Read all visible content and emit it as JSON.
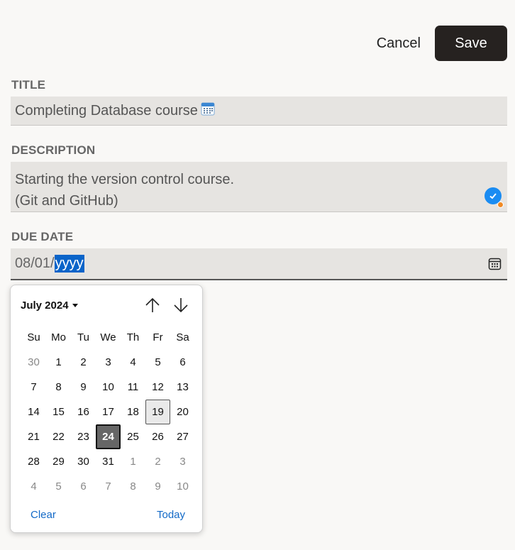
{
  "actions": {
    "cancel_label": "Cancel",
    "save_label": "Save"
  },
  "title": {
    "label": "TITLE",
    "value": "Completing Database course"
  },
  "description": {
    "label": "DESCRIPTION",
    "lines": [
      "Starting the version control course.",
      "(Git and GitHub)"
    ]
  },
  "due_date": {
    "label": "DUE DATE",
    "prefix": "08/01/",
    "selected": "yyyy"
  },
  "calendar": {
    "month_label": "July 2024",
    "weekdays": [
      "Su",
      "Mo",
      "Tu",
      "We",
      "Th",
      "Fr",
      "Sa"
    ],
    "weeks": [
      [
        {
          "d": "30",
          "o": true
        },
        {
          "d": "1"
        },
        {
          "d": "2"
        },
        {
          "d": "3"
        },
        {
          "d": "4"
        },
        {
          "d": "5"
        },
        {
          "d": "6"
        }
      ],
      [
        {
          "d": "7"
        },
        {
          "d": "8"
        },
        {
          "d": "9"
        },
        {
          "d": "10"
        },
        {
          "d": "11"
        },
        {
          "d": "12"
        },
        {
          "d": "13"
        }
      ],
      [
        {
          "d": "14"
        },
        {
          "d": "15"
        },
        {
          "d": "16"
        },
        {
          "d": "17"
        },
        {
          "d": "18"
        },
        {
          "d": "19",
          "h": true
        },
        {
          "d": "20"
        }
      ],
      [
        {
          "d": "21"
        },
        {
          "d": "22"
        },
        {
          "d": "23"
        },
        {
          "d": "24",
          "s": true
        },
        {
          "d": "25"
        },
        {
          "d": "26"
        },
        {
          "d": "27"
        }
      ],
      [
        {
          "d": "28"
        },
        {
          "d": "29"
        },
        {
          "d": "30"
        },
        {
          "d": "31"
        },
        {
          "d": "1",
          "o": true
        },
        {
          "d": "2",
          "o": true
        },
        {
          "d": "3",
          "o": true
        }
      ],
      [
        {
          "d": "4",
          "o": true
        },
        {
          "d": "5",
          "o": true
        },
        {
          "d": "6",
          "o": true
        },
        {
          "d": "7",
          "o": true
        },
        {
          "d": "8",
          "o": true
        },
        {
          "d": "9",
          "o": true
        },
        {
          "d": "10",
          "o": true
        }
      ]
    ],
    "clear_label": "Clear",
    "today_label": "Today"
  },
  "colors": {
    "accent": "#1269c7",
    "save_bg": "#262220",
    "selection": "#0a64c9",
    "check_badge": "#1a8cf2"
  }
}
